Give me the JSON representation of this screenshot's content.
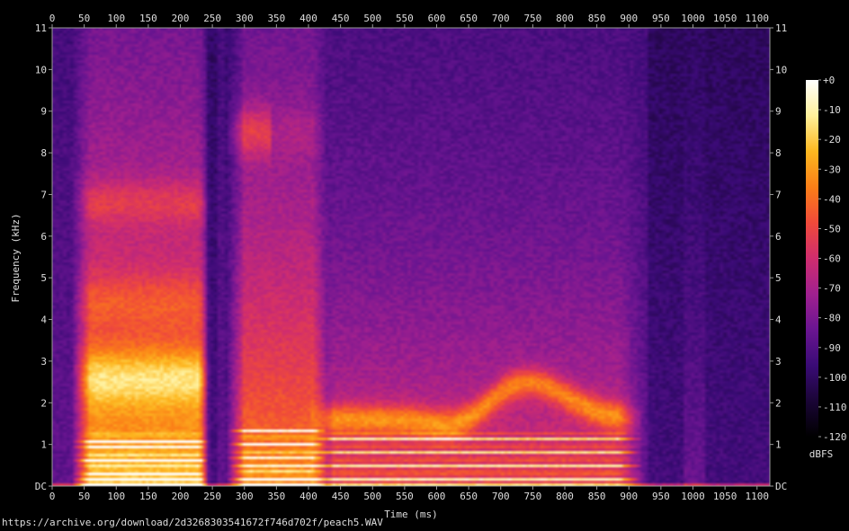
{
  "chart_data": {
    "type": "heatmap",
    "xlabel": "Time (ms)",
    "ylabel": "Frequency (kHz)",
    "x_range": [
      0,
      1120
    ],
    "y_range": [
      0,
      11
    ],
    "x_ticks": [
      "0",
      "50",
      "100",
      "150",
      "200",
      "250",
      "300",
      "350",
      "400",
      "450",
      "500",
      "550",
      "600",
      "650",
      "700",
      "750",
      "800",
      "850",
      "900",
      "950",
      "1000",
      "1050",
      "1100"
    ],
    "y_ticks": [
      "DC",
      "1",
      "2",
      "3",
      "4",
      "5",
      "6",
      "7",
      "8",
      "9",
      "10",
      "11"
    ],
    "colorbar": {
      "label": "dBFS",
      "range": [
        -120,
        0
      ],
      "ticks": [
        "+0",
        "-10",
        "-20",
        "-30",
        "-40",
        "-50",
        "-60",
        "-70",
        "-80",
        "-90",
        "-100",
        "-110",
        "-120"
      ],
      "colormap": [
        "#000000",
        "#1a0536",
        "#3a0b76",
        "#6a1591",
        "#a0208f",
        "#d02d6e",
        "#f04a3a",
        "#fb7f17",
        "#fdb820",
        "#fff09a",
        "#ffffff"
      ]
    },
    "activity_profile": {
      "description_units": "time ms vs approximate upper frequency (kHz) of strong energy",
      "segments": [
        {
          "t_start": 30,
          "t_end": 240,
          "level": "loud"
        },
        {
          "t_start": 290,
          "t_end": 420,
          "level": "loud"
        },
        {
          "t_start": 420,
          "t_end": 920,
          "level": "medium"
        },
        {
          "t_start": 990,
          "t_end": 1020,
          "level": "faint"
        }
      ]
    }
  },
  "footer": {
    "url": "https://archive.org/download/2d3268303541672f746d702f/peach5.WAV"
  }
}
